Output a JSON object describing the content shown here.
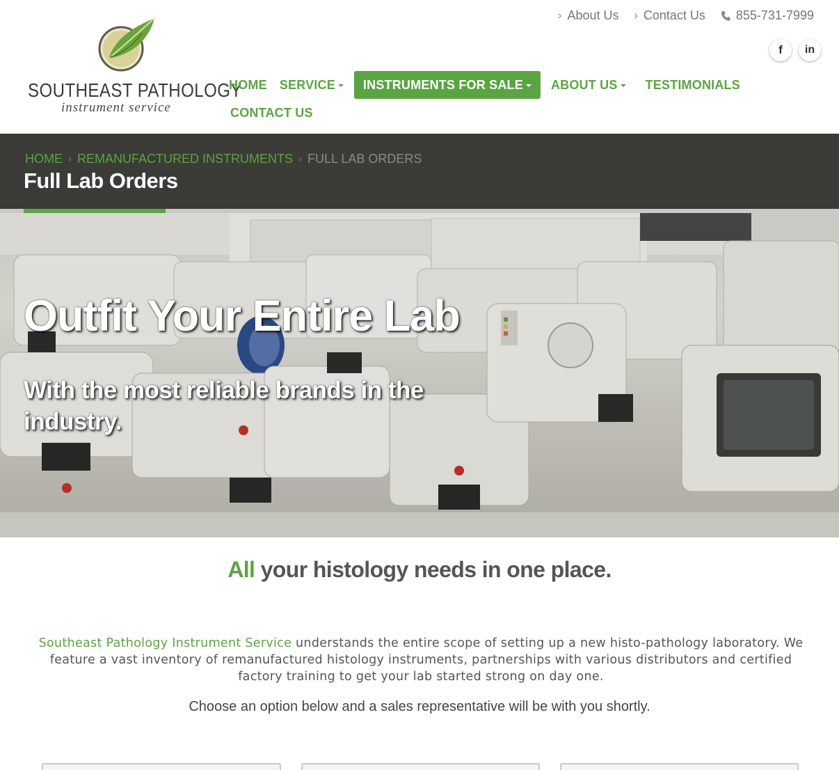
{
  "brand": {
    "name": "SOUTHEAST PATHOLOGY",
    "tagline": "instrument service",
    "leaf_color": "#6aa33a"
  },
  "topbar": {
    "links": [
      {
        "label": "About Us",
        "icon": "chevron-right-icon"
      },
      {
        "label": "Contact Us",
        "icon": "chevron-right-icon"
      }
    ],
    "phone": "855-731-7999",
    "phone_icon": "phone-icon"
  },
  "social": [
    {
      "label": "f",
      "icon": "facebook-icon"
    },
    {
      "label": "in",
      "icon": "linkedin-icon"
    }
  ],
  "nav": {
    "items": [
      {
        "label": "HOME",
        "dropdown": false,
        "active": false
      },
      {
        "label": "SERVICE",
        "dropdown": true,
        "active": false
      },
      {
        "label": "INSTRUMENTS FOR SALE",
        "dropdown": true,
        "active": true
      },
      {
        "label": "ABOUT US",
        "dropdown": true,
        "active": false
      },
      {
        "label": "TESTIMONIALS",
        "dropdown": false,
        "active": false
      },
      {
        "label": "CONTACT US",
        "dropdown": false,
        "active": false
      }
    ]
  },
  "breadcrumb": {
    "items": [
      "HOME",
      "REMANUFACTURED INSTRUMENTS"
    ],
    "current": "FULL LAB ORDERS"
  },
  "page": {
    "title": "Full Lab Orders"
  },
  "hero": {
    "title": "Outfit Your Entire Lab",
    "subtitle": "With the most reliable brands in the industry."
  },
  "content": {
    "tagline_accent": "All",
    "tagline_rest": " your histology needs in one place.",
    "intro_accent": "Southeast Pathology Instrument Service",
    "intro_rest": " understands the entire scope of setting up a new histo-pathology laboratory. We feature a vast inventory of remanufactured histology instruments, partnerships with various distributors and certified factory training to get your lab started strong on day one.",
    "choose": "Choose an option below and a sales representative will be with you shortly."
  },
  "colors": {
    "accent": "#5aa542",
    "titlebar_bg": "#3b3b37",
    "text": "#555555"
  }
}
